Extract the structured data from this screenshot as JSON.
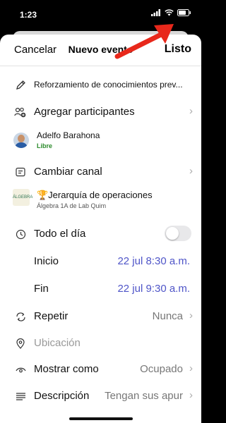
{
  "status_bar": {
    "time": "1:23"
  },
  "nav": {
    "cancel": "Cancelar",
    "title": "Nuevo evento",
    "done": "Listo"
  },
  "title_field": {
    "value": "Reforzamiento de conocimientos prev..."
  },
  "participants": {
    "label": "Agregar participantes"
  },
  "attendee": {
    "name": "Adelfo Barahona",
    "status": "Libre"
  },
  "channel": {
    "label": "Cambiar canal"
  },
  "selected_channel": {
    "name": "🏆Jerarquía de operaciones",
    "team": "Álgebra 1A de Lab Quim",
    "logo_text": "ÁLGEBRA"
  },
  "all_day": {
    "label": "Todo el día",
    "on": false
  },
  "start": {
    "label": "Inicio",
    "value": "22 jul 8:30 a.m."
  },
  "end": {
    "label": "Fin",
    "value": "22 jul 9:30 a.m."
  },
  "repeat": {
    "label": "Repetir",
    "value": "Nunca"
  },
  "location": {
    "placeholder": "Ubicación"
  },
  "show_as": {
    "label": "Mostrar como",
    "value": "Ocupado"
  },
  "description": {
    "label": "Descripción",
    "value": "Tengan sus apur"
  },
  "colors": {
    "accent": "#4f55c8",
    "green": "#2a8a2a",
    "arrow": "#e8281b"
  }
}
